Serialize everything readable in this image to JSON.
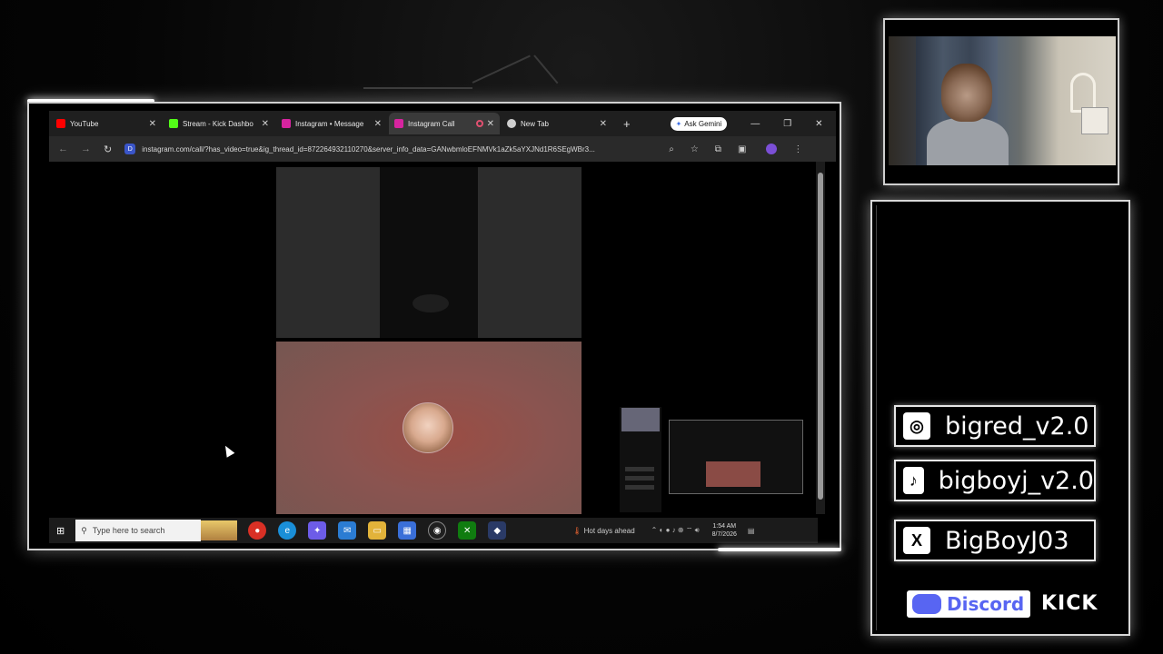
{
  "colors": {
    "accent_glow": "#ffffff",
    "discord": "#5865f2",
    "tab_active": "#3a3a3a",
    "call_tile": "#8a5450"
  },
  "browser": {
    "tabs": [
      {
        "label": "YouTube",
        "icon": "youtube-icon",
        "icon_color": "#ff0000",
        "active": false
      },
      {
        "label": "Stream - Kick Dashbo",
        "icon": "kick-icon",
        "icon_color": "#53fc18",
        "active": false
      },
      {
        "label": "Instagram • Message",
        "icon": "instagram-icon",
        "icon_color": "#d6249f",
        "active": false
      },
      {
        "label": "Instagram Call",
        "icon": "instagram-icon",
        "icon_color": "#d6249f",
        "active": true,
        "recording": true
      },
      {
        "label": "New Tab",
        "icon": "chrome-icon",
        "icon_color": "#cfcfcf",
        "active": false
      }
    ],
    "new_tab_symbol": "+",
    "gemini_label": "Ask Gemini",
    "url": "instagram.com/call/?has_video=true&ig_thread_id=872264932110270&server_info_data=GANwbmloEFNMVk1aZk5aYXJNd1R6SEgWBr3...",
    "site_icon_letter": "D"
  },
  "taskbar": {
    "search_placeholder": "Type here to search",
    "weather": "Hot days ahead",
    "time": "1:54 AM",
    "date": "8/7/2026"
  },
  "socials": [
    {
      "icon": "instagram-icon",
      "name": "bigred_v2.0"
    },
    {
      "icon": "tiktok-icon",
      "name": "bigboyj_v2.0"
    },
    {
      "icon": "x-icon",
      "name": "BigBoyJ03"
    }
  ],
  "discord_label": "Discord",
  "kick_label": "KICK"
}
